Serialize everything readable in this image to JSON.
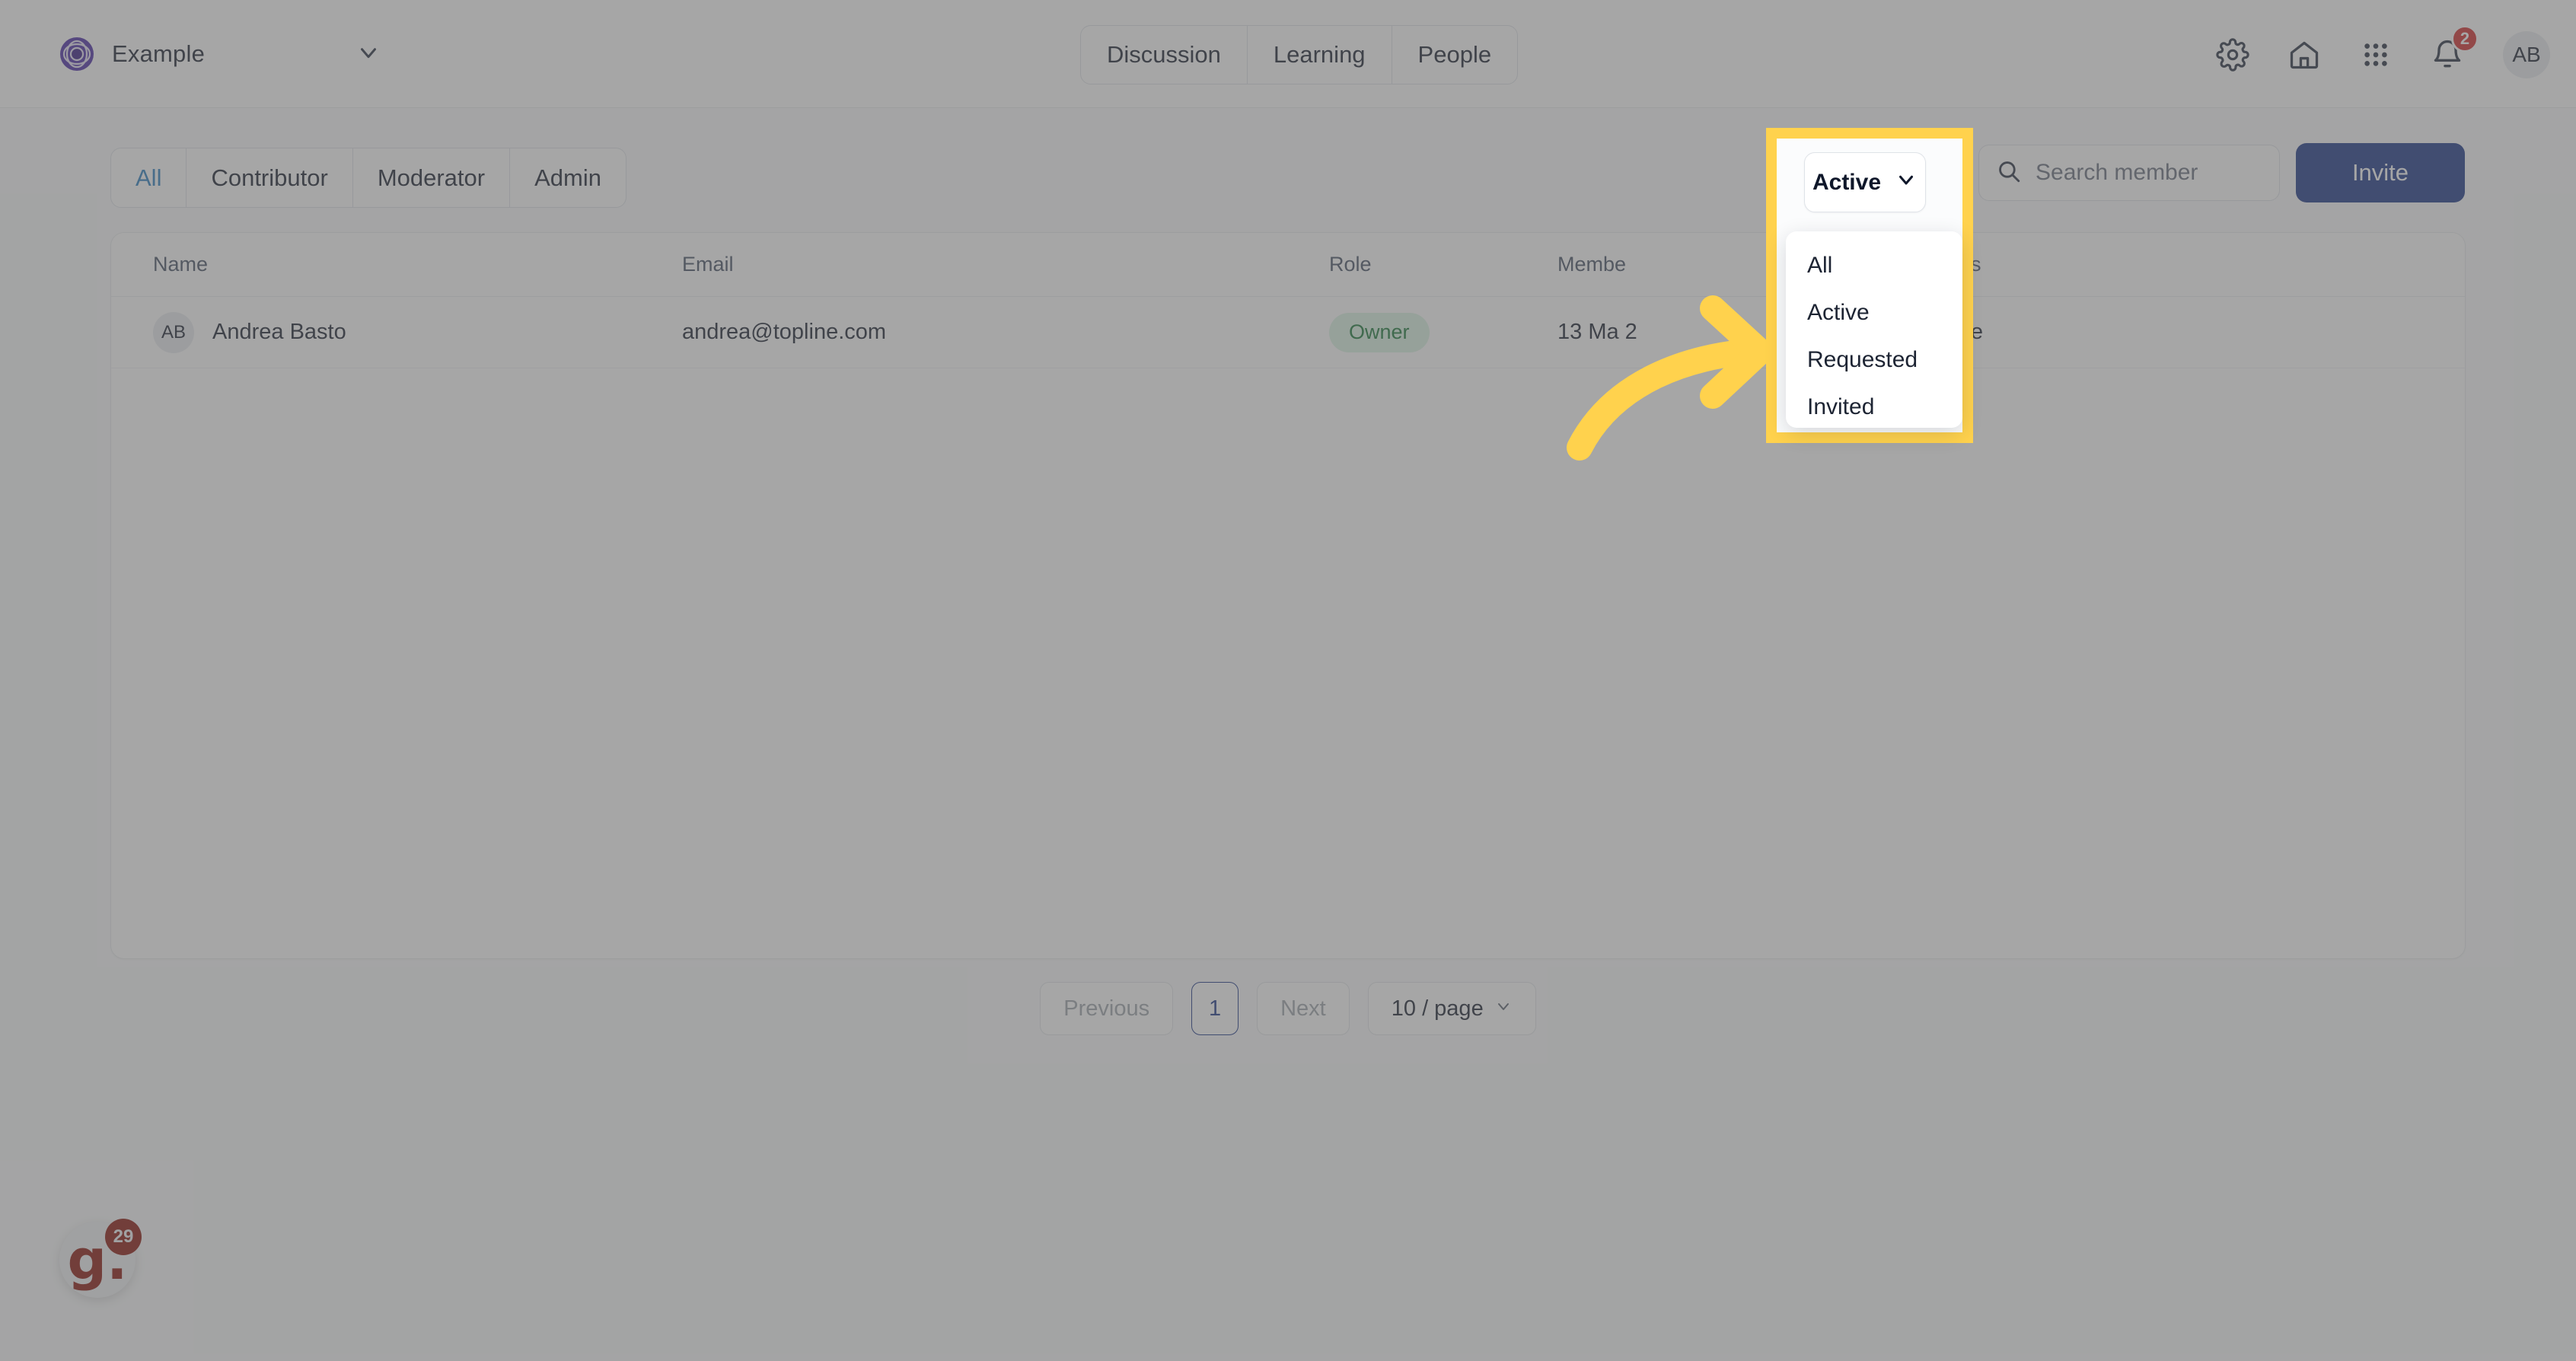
{
  "topbar": {
    "org_name": "Example",
    "org_logo_icon": "circles-logo-icon",
    "org_caret_icon": "chevron-down-icon",
    "nav_tabs": [
      {
        "label": "Discussion"
      },
      {
        "label": "Learning"
      },
      {
        "label": "People"
      }
    ],
    "icons": [
      {
        "name": "gear-icon"
      },
      {
        "name": "home-icon"
      },
      {
        "name": "grid-apps-icon"
      },
      {
        "name": "bell-icon"
      }
    ],
    "notification_count": "2",
    "avatar_initials": "AB"
  },
  "toolbar": {
    "role_tabs": [
      {
        "label": "All",
        "active": true
      },
      {
        "label": "Contributor",
        "active": false
      },
      {
        "label": "Moderator",
        "active": false
      },
      {
        "label": "Admin",
        "active": false
      }
    ],
    "status_filter": {
      "selected": "Active",
      "caret_icon": "chevron-down-icon",
      "options": [
        "All",
        "Active",
        "Requested",
        "Invited"
      ]
    },
    "search": {
      "placeholder": "Search member",
      "value": "",
      "icon": "search-icon"
    },
    "invite_label": "Invite"
  },
  "table": {
    "columns": [
      "Name",
      "Email",
      "Role",
      "Membe",
      "Status"
    ],
    "rows": [
      {
        "avatar": "AB",
        "name": "Andrea Basto",
        "email": "andrea@topline.com",
        "role": "Owner",
        "member_since": "13 Ma  2",
        "status": "Active"
      }
    ]
  },
  "pagination": {
    "previous_label": "Previous",
    "page_label": "1",
    "next_label": "Next",
    "per_page_label": "10 / page",
    "per_page_caret_icon": "chevron-down-icon"
  },
  "help_widget": {
    "glyph": "g.",
    "badge": "29"
  },
  "colors": {
    "accent_blue": "#1f3a8a",
    "active_tab": "#2f80c2",
    "highlight_yellow": "#ffd24d",
    "badge_red": "#d32f2f",
    "role_badge_text": "#1e7a3c",
    "role_badge_bg": "#dcf3e4",
    "brand_purple": "#4f2fa8"
  }
}
